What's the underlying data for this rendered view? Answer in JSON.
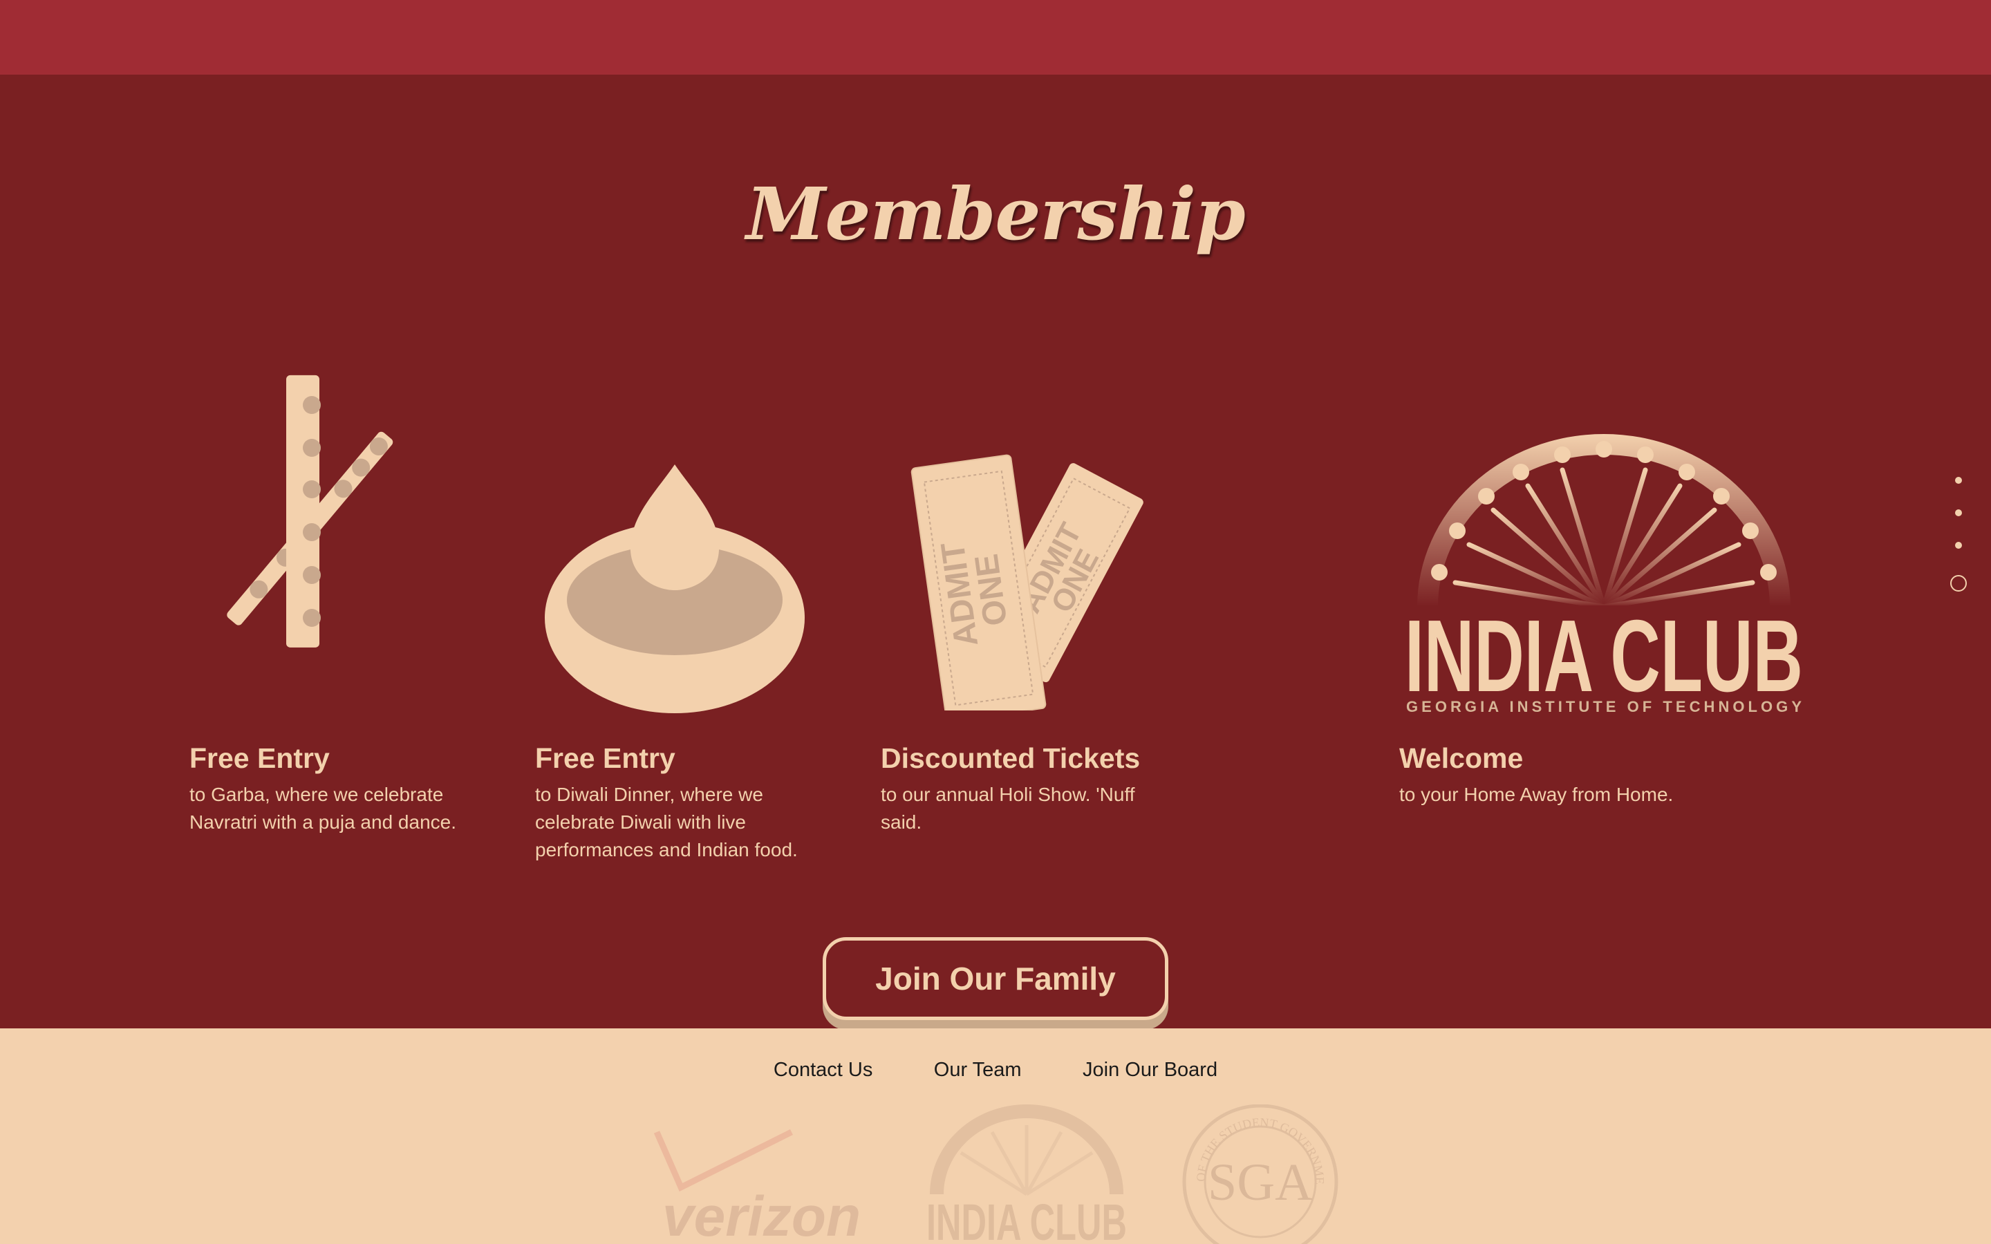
{
  "page": {
    "title": "Membership",
    "join_button": "Join Our Family"
  },
  "features": [
    {
      "icon": "dandiya-sticks-icon",
      "heading": "Free Entry",
      "text": "to Garba, where we celebrate Navratri with a puja and dance."
    },
    {
      "icon": "diya-lamp-icon",
      "heading": "Free Entry",
      "text": "to Diwali Dinner, where we celebrate Diwali with live performances and Indian food."
    },
    {
      "icon": "tickets-icon",
      "heading": "Discounted Tickets",
      "text": "to our annual Holi Show. 'Nuff said."
    },
    {
      "icon": "india-club-logo",
      "heading": "Welcome",
      "text": "to your Home Away from Home."
    }
  ],
  "tickets": {
    "stub1": [
      "ADMIT",
      "ONE"
    ],
    "stub2": [
      "ADMIT",
      "ONE"
    ]
  },
  "logo": {
    "wordmark": "INDIA CLUB",
    "subtitle": "GEORGIA INSTITUTE OF TECHNOLOGY"
  },
  "footer": {
    "links": [
      "Contact Us",
      "Our Team",
      "Join Our Board"
    ],
    "sponsors": {
      "verizon": "verizon",
      "india_club": "INDIA CLUB",
      "sga": "SGA",
      "sga_ring": "OF THE STUDENT GOVERNMENT ASSOCIATION"
    }
  },
  "colors": {
    "header": "#a02c34",
    "main": "#7a2022",
    "accent": "#f3d1ad",
    "footer": "#f3d1ae"
  },
  "nav_dots": {
    "count": 4,
    "active_index": 3
  }
}
